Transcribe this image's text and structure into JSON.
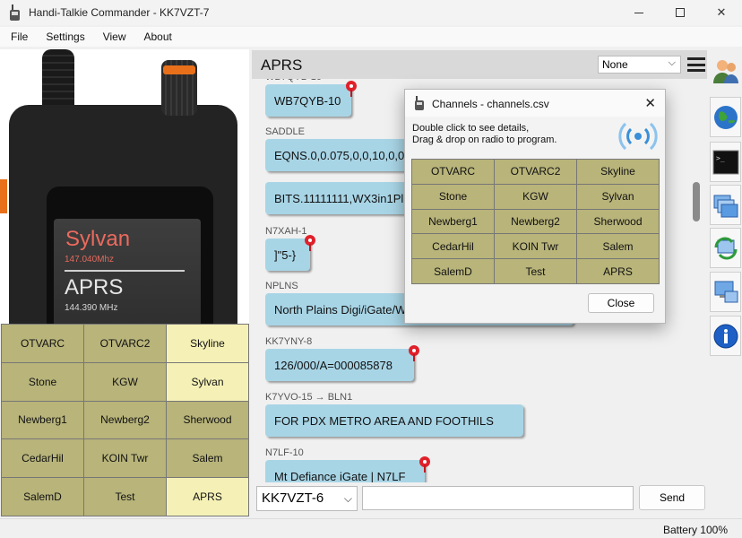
{
  "window": {
    "title": "Handi-Talkie Commander - KK7VZT-7"
  },
  "menu": [
    "File",
    "Settings",
    "View",
    "About"
  ],
  "radio_screen": {
    "channel_a": "Sylvan",
    "freq_a": "147.040Mhz",
    "channel_b": "APRS",
    "freq_b": "144.390 MHz",
    "signal_level": 0.91
  },
  "channels": [
    {
      "label": "OTVARC",
      "active": false
    },
    {
      "label": "OTVARC2",
      "active": false
    },
    {
      "label": "Skyline",
      "active": true
    },
    {
      "label": "Stone",
      "active": false
    },
    {
      "label": "KGW",
      "active": false
    },
    {
      "label": "Sylvan",
      "active": true
    },
    {
      "label": "Newberg1",
      "active": false
    },
    {
      "label": "Newberg2",
      "active": false
    },
    {
      "label": "Sherwood",
      "active": false
    },
    {
      "label": "CedarHil",
      "active": false
    },
    {
      "label": "KOIN Twr",
      "active": false
    },
    {
      "label": "Salem",
      "active": false
    },
    {
      "label": "SalemD",
      "active": false
    },
    {
      "label": "Test",
      "active": false
    },
    {
      "label": "APRS",
      "active": true
    }
  ],
  "aprs": {
    "title": "APRS",
    "filter": "None",
    "messages": [
      {
        "from": "WB7QYB-10",
        "text": "WB7QYB-10",
        "pin": true
      },
      {
        "from": "SADDLE",
        "text": "EQNS.0,0.075,0,0,10,0,0,0.2,0,0,1,0",
        "pin": false
      },
      {
        "from": "",
        "text": "BITS.11111111,WX3in1Plus2.0",
        "pin": false
      },
      {
        "from": "N7XAH-1",
        "text": "]\"5-}",
        "pin": true
      },
      {
        "from": "NPLNS",
        "text": "North Plains Digi/iGate/Weather Station",
        "pin": false
      },
      {
        "from": "KK7YNY-8",
        "text": "126/000/A=000085878",
        "pin": true
      },
      {
        "from": "K7YVO-15 → BLN1",
        "text": "FOR PDX METRO AREA AND FOOTHILS",
        "pin": false
      },
      {
        "from": "N7LF-10",
        "text": "Mt Defiance iGate | N7LF",
        "pin": true
      }
    ]
  },
  "compose": {
    "station": "KK7VZT-6",
    "message": "",
    "send_label": "Send"
  },
  "status": {
    "battery": "Battery 100%"
  },
  "dialog": {
    "title": "Channels - channels.csv",
    "help_line1": "Double click to see details,",
    "help_line2": "Drag & drop on radio to program.",
    "close_label": "Close",
    "channels": [
      "OTVARC",
      "OTVARC2",
      "Skyline",
      "Stone",
      "KGW",
      "Sylvan",
      "Newberg1",
      "Newberg2",
      "Sherwood",
      "CedarHil",
      "KOIN Twr",
      "Salem",
      "SalemD",
      "Test",
      "APRS"
    ]
  },
  "colors": {
    "channel_button": "#b8b47a",
    "channel_button_active": "#f5f1b6",
    "bubble": "#a8d5e6",
    "pin": "#e0202a"
  },
  "icons": [
    "users-icon",
    "globe-icon",
    "terminal-icon",
    "windows-icon",
    "sync-icon",
    "network-icon",
    "info-icon",
    "hamburger-menu-icon",
    "map-pin-icon",
    "radio-signal-icon"
  ]
}
